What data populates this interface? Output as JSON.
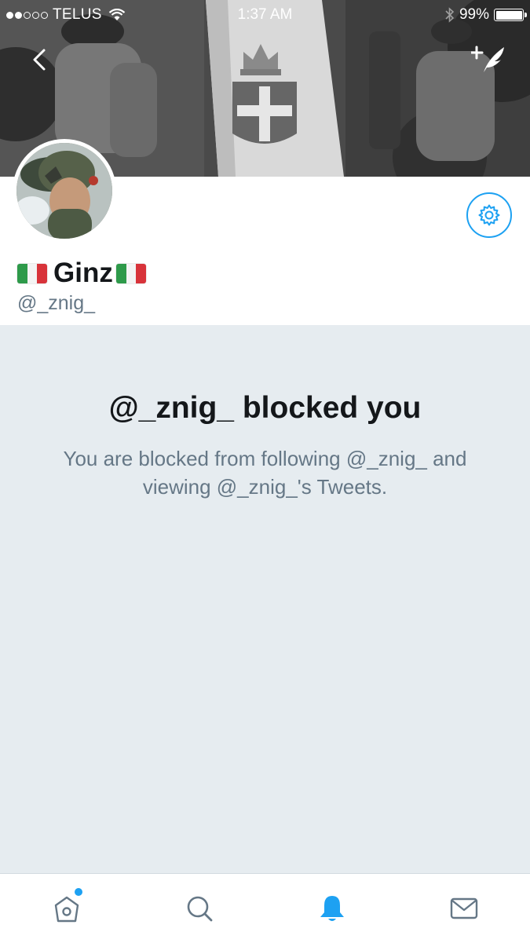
{
  "status_bar": {
    "signal_dots_filled": 2,
    "signal_dots_total": 5,
    "carrier": "TELUS",
    "time": "1:37 AM",
    "battery": "99%",
    "battery_level": 0.99
  },
  "header": {
    "back_icon": "chevron-left-icon",
    "compose_icon": "compose-tweet-icon"
  },
  "profile": {
    "display_name": "Ginz",
    "name_flag": "italy-flag",
    "handle": "@_znig_",
    "settings_icon": "gear-icon"
  },
  "blocked": {
    "title": "@_znig_ blocked you",
    "message": "You are blocked from following @_znig_ and viewing @_znig_'s Tweets."
  },
  "tab_bar": {
    "tabs": [
      {
        "icon": "home-icon",
        "active": false,
        "has_dot": true
      },
      {
        "icon": "search-icon",
        "active": false
      },
      {
        "icon": "notifications-bell-icon",
        "active": true
      },
      {
        "icon": "messages-envelope-icon",
        "active": false
      }
    ]
  },
  "colors": {
    "accent": "#1da1f2",
    "secondary_text": "#657786",
    "primary_text": "#14171a",
    "panel_background": "#e6ecf0"
  }
}
